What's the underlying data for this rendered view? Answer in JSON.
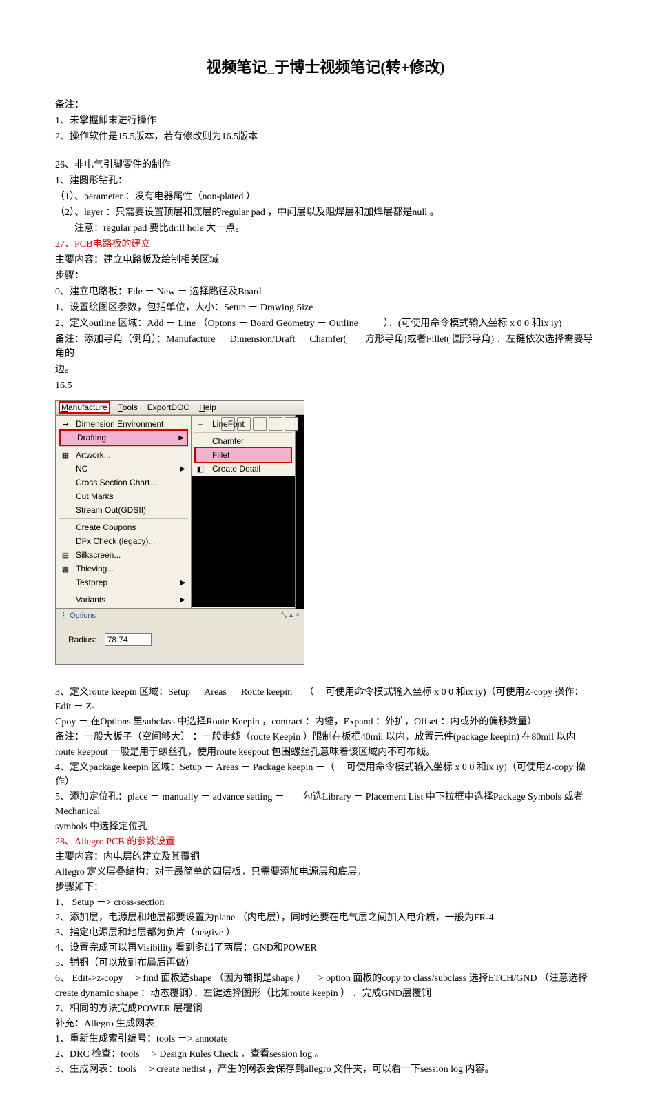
{
  "title": "视频笔记_于博士视频笔记(转+修改)",
  "head_note_label": "备注：",
  "head_note_1": "1、未掌握即末进行操作",
  "head_note_2": "2、操作软件是15.5版本，若有修改则为16.5版本",
  "s26_title": "26、非电气引脚零件的制作",
  "s26_l1": "1、建圆形钻孔：",
  "s26_l2": "（1）、parameter ：没有电器属性（non-plated ）",
  "s26_l3": "（2）、layer ：只需要设置顶层和底层的regular pad ，中间层以及阻焊层和加焊层都是null 。",
  "s26_l4": "注意：regular pad  要比drill hole  大一点。",
  "s27_title": "27、PCB电路板的建立",
  "s27_l1": "主要内容：建立电路板及绘制相关区域",
  "s27_l2": "步骤：",
  "s27_l3": "0、建立电路板：File － New － 选择路径及Board",
  "s27_l4": "1、设置绘图区参数，包括单位，大小：Setup － Drawing Size",
  "s27_l5a": "2、定义outline 区域：Add － Line （Optons － Board Geometry － Outline",
  "s27_l5b": "）．(可使用命令模式输入坐标 x 0 0 和ix iy)",
  "s27_l6a": "备注：添加导角（倒角）：Manufacture － Dimension/Draft － Chamfer(",
  "s27_l6b": "方形导角)或者Fillet( 圆形导角) ．左键依次选择需要导角的",
  "s27_l7": "边。",
  "s27_l8": "16.5",
  "menubar": {
    "manufacture": "Manufacture",
    "tools": "Tools",
    "exportdoc": "ExportDOC",
    "help": "Help"
  },
  "menu1": {
    "dimension_env": "Dimension Environment",
    "drafting": "Drafting",
    "artwork": "Artwork...",
    "nc": "NC",
    "cross_section": "Cross Section Chart...",
    "cut_marks": "Cut Marks",
    "stream_out": "Stream Out(GDSII)",
    "create_coupons": "Create Coupons",
    "dfx_check": "DFx Check (legacy)...",
    "silkscreen": "Silkscreen...",
    "thieving": "Thieving...",
    "testprep": "Testprep",
    "variants": "Variants"
  },
  "menu2": {
    "linefont": "LineFont",
    "chamfer": "Chamfer",
    "fillet": "Fillet",
    "create_detail": "Create Detail"
  },
  "options_label": "Options",
  "radius_label": "Radius:",
  "radius_value": "78.74",
  "s3_a": "3、定义route keepin 区域：Setup － Areas － Route keepin －（",
  "s3_b": "可使用命令模式输入坐标 x 0 0 和ix iy)（可使用Z-copy 操作：Edit － Z-",
  "s3_c": "Cpoy － 在Options 里subclass 中选择Route Keepin ，contract ：内缩，Expand ：外扩，Offset ：内或外的偏移数量）",
  "s3_note": "备注：一般大板子（空间够大） ：一般走线（route Keepin ）限制在板框40mil 以内，放置元件(package keepin)  在80mil 以内",
  "s3_d": "route keepout     一般是用于螺丝孔，使用route keepout 包围螺丝孔意味着该区域内不可布线。",
  "s4_a": "4、定义package keepin 区域：Setup － Areas － Package keepin －（",
  "s4_b": "可使用命令模式输入坐标 x 0 0 和ix iy)（可使用Z-copy 操作）",
  "s5_a": "5、添加定位孔：place － manually － advance setting －",
  "s5_b": "勾选Library － Placement List     中下拉框中选择Package Symbols   或者Mechanical",
  "s5_c": "symbols 中选择定位孔",
  "s28_title": "28、Allegro PCB     的参数设置",
  "s28_l1": "主要内容：内电层的建立及其覆铜",
  "s28_l2": "Allegro 定义层叠结构：对于最简单的四层板，只需要添加电源层和底层，",
  "s28_l3": "步骤如下：",
  "s28_s1": "1、 Setup －> cross-section",
  "s28_s2": "2、添加层，电源层和地层都要设置为plane   （内电层），同时还要在电气层之间加入电介质，一般为FR-4",
  "s28_s3": "3、指定电源层和地层都为负片（negtive ）",
  "s28_s4": "4、设置完成可以再Visibility  看到多出了两层：GND和POWER",
  "s28_s5": "5、铺铜（可以放到布局后再做）",
  "s28_s6a": "6、 Edit->z-copy －> find  面板选shape （因为铺铜是shape ） －> option 面板的copy to class/subclass   选择ETCH/GND （注意选择",
  "s28_s6b": "create dynamic shape  ：动态覆铜）．左键选择图形（比如route keepin ） ．完成GND层覆铜",
  "s28_s7": "7、相同的方法完成POWER 层覆铜",
  "s28_extra_label": "补充：Allegro 生成网表",
  "s28_e1": "1、重新生成索引编号：tools －> annotate",
  "s28_e2": "2、DRC 检查：tools －> Design Rules Check    ，查看session log 。",
  "s28_e3": "3、生成网表：tools －> create netlist  ，产生的网表会保存到allegro 文件夹，可以看一下session log 内容。"
}
